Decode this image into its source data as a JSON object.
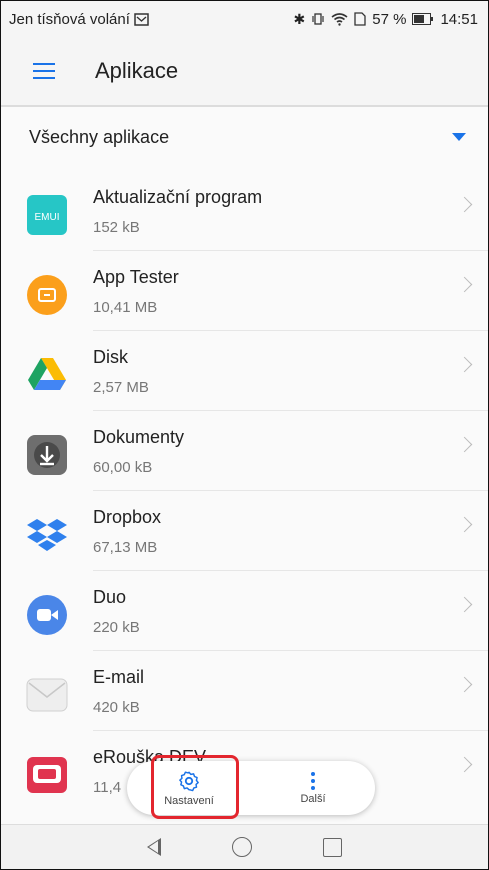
{
  "status": {
    "carrier": "Jen tísňová volání",
    "battery": "57 %",
    "time": "14:51"
  },
  "header": {
    "title": "Aplikace"
  },
  "filter": {
    "label": "Všechny aplikace"
  },
  "apps": [
    {
      "name": "Aktualizační program",
      "size": "152 kB",
      "icon": "emui-icon"
    },
    {
      "name": "App Tester",
      "size": "10,41 MB",
      "icon": "app-tester-icon"
    },
    {
      "name": "Disk",
      "size": "2,57 MB",
      "icon": "drive-icon"
    },
    {
      "name": "Dokumenty",
      "size": "60,00 kB",
      "icon": "documents-icon"
    },
    {
      "name": "Dropbox",
      "size": "67,13 MB",
      "icon": "dropbox-icon"
    },
    {
      "name": "Duo",
      "size": "220 kB",
      "icon": "duo-icon"
    },
    {
      "name": "E-mail",
      "size": "420 kB",
      "icon": "email-icon"
    },
    {
      "name": "eRouška DEV",
      "size": "11,4",
      "icon": "erouska-icon"
    }
  ],
  "popup": {
    "settings_label": "Nastavení",
    "more_label": "Další"
  },
  "colors": {
    "accent": "#1a73e8",
    "highlight": "#e3262e"
  }
}
